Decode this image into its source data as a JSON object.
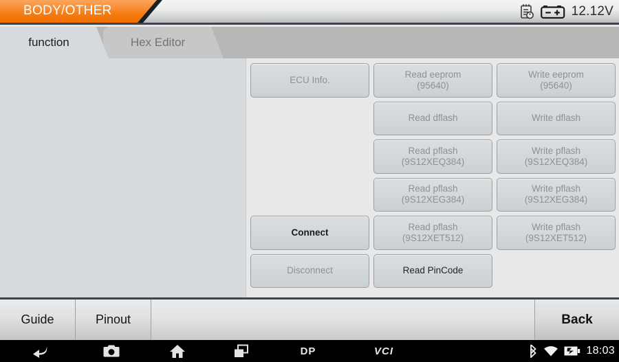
{
  "titlebar": {
    "title": "BODY/OTHER",
    "voltage": "12.12V",
    "report_icon": "clipboard-clock-icon",
    "battery_icon": "car-battery-icon"
  },
  "tabs": [
    {
      "label": "function",
      "active": true
    },
    {
      "label": "Hex Editor",
      "active": false
    }
  ],
  "grid": {
    "rows": [
      [
        {
          "label": "ECU Info.",
          "sub": "",
          "enabled": false
        },
        {
          "label": "Read eeprom",
          "sub": "(95640)",
          "enabled": false
        },
        {
          "label": "Write eeprom",
          "sub": "(95640)",
          "enabled": false
        }
      ],
      [
        {
          "label": "",
          "sub": "",
          "empty": true
        },
        {
          "label": "Read dflash",
          "sub": "",
          "enabled": false
        },
        {
          "label": "Write dflash",
          "sub": "",
          "enabled": false
        }
      ],
      [
        {
          "label": "",
          "sub": "",
          "empty": true
        },
        {
          "label": "Read pflash",
          "sub": "(9S12XEQ384)",
          "enabled": false
        },
        {
          "label": "Write pflash",
          "sub": "(9S12XEQ384)",
          "enabled": false
        }
      ],
      [
        {
          "label": "",
          "sub": "",
          "empty": true
        },
        {
          "label": "Read pflash",
          "sub": "(9S12XEG384)",
          "enabled": false
        },
        {
          "label": "Write pflash",
          "sub": "(9S12XEG384)",
          "enabled": false
        }
      ],
      [
        {
          "label": "Connect",
          "sub": "",
          "enabled": true
        },
        {
          "label": "Read pflash",
          "sub": "(9S12XET512)",
          "enabled": false
        },
        {
          "label": "Write pflash",
          "sub": "(9S12XET512)",
          "enabled": false
        }
      ],
      [
        {
          "label": "Disconnect",
          "sub": "",
          "enabled": false
        },
        {
          "label": "Read PinCode",
          "sub": "",
          "enabled": true,
          "normal_weight": true
        },
        {
          "label": "",
          "sub": "",
          "empty": true
        }
      ]
    ]
  },
  "toolbar": {
    "guide_label": "Guide",
    "pinout_label": "Pinout",
    "back_label": "Back"
  },
  "navbar": {
    "back_icon": "back-arrow-icon",
    "screenshot_icon": "camera-icon",
    "home_icon": "home-icon",
    "recents_icon": "recent-apps-icon",
    "dp_label": "DP",
    "vci_label": "VCI",
    "bluetooth_icon": "bluetooth-icon",
    "wifi_icon": "wifi-icon",
    "battery_icon": "battery-charging-icon",
    "clock": "18:03"
  },
  "colors": {
    "accent": "#f57c10",
    "titlebar_border": "#3c4450",
    "left_panel": "#d6dadd",
    "button_fill": "#d4d9dc",
    "button_border": "#9a9fa3",
    "disabled_text": "#8d9196",
    "enabled_text": "#1a1a1a"
  }
}
